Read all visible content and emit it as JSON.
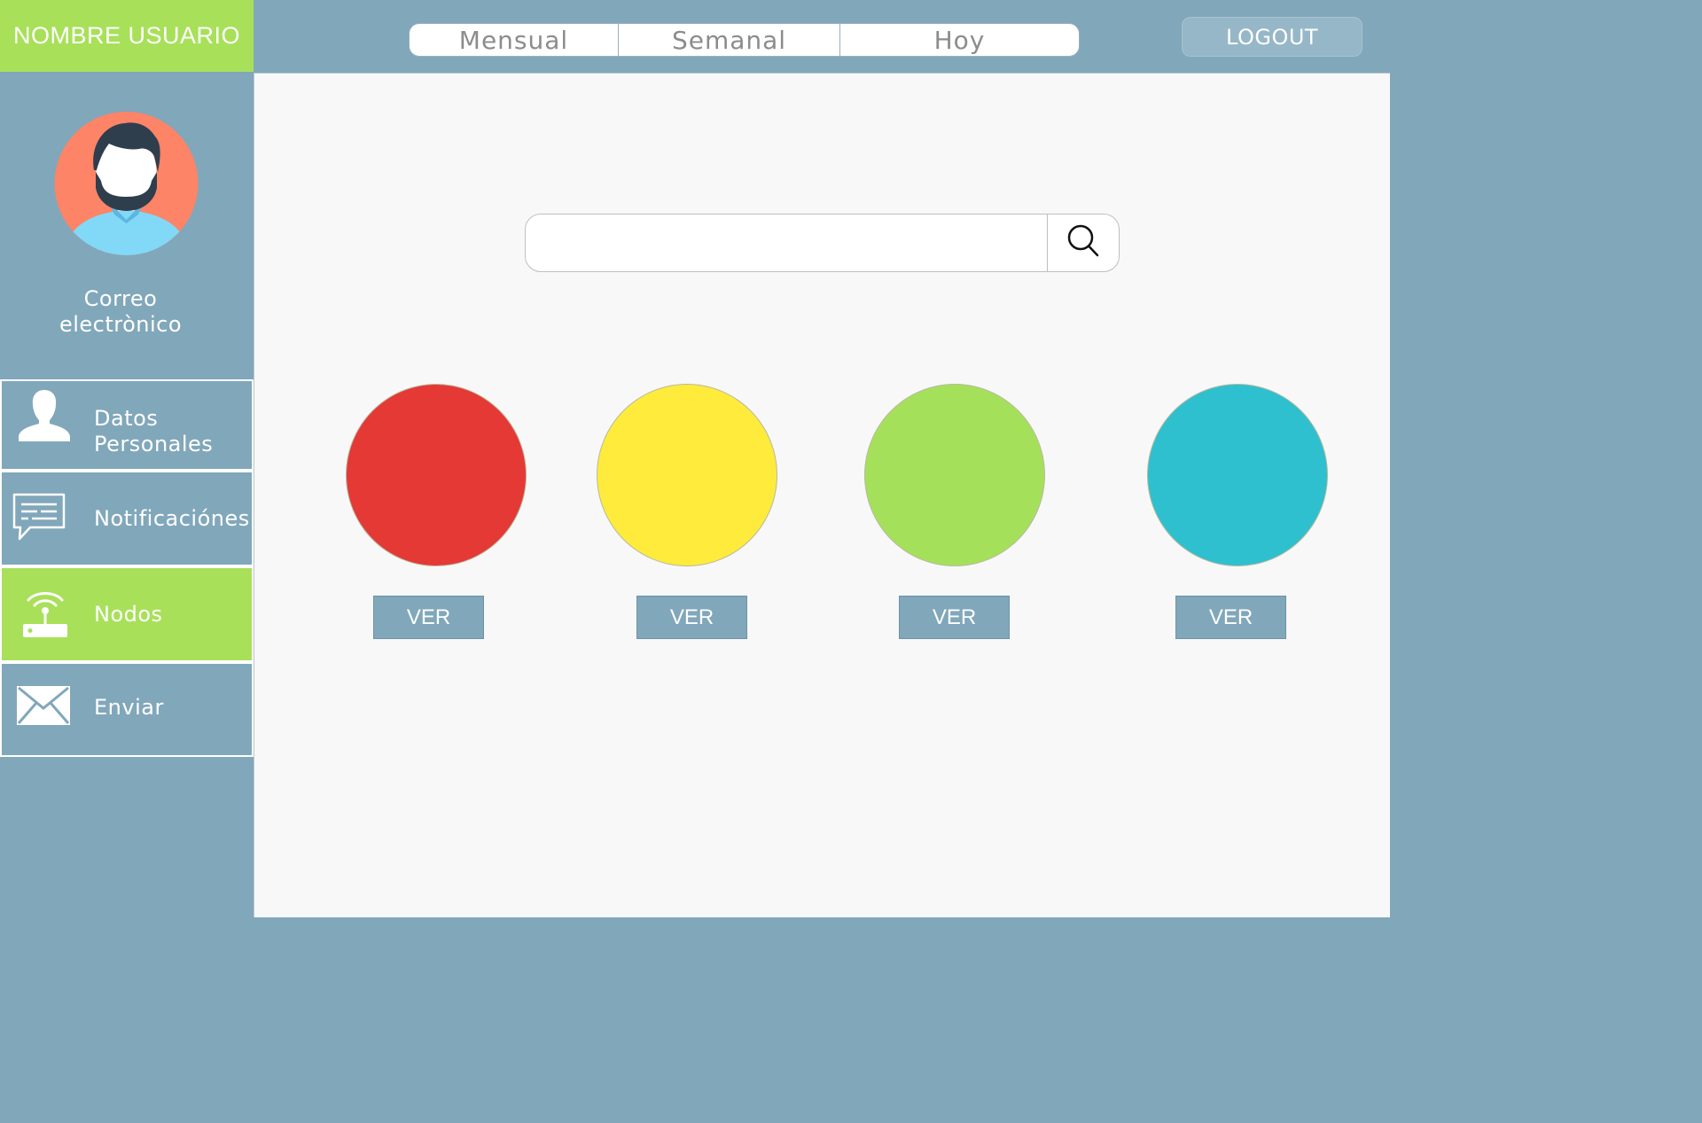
{
  "header": {
    "user_name": "NOMBRE USUARIO",
    "tabs": [
      {
        "label": "Mensual"
      },
      {
        "label": "Semanal"
      },
      {
        "label": "Hoy"
      }
    ],
    "logout_label": "LOGOUT"
  },
  "sidebar": {
    "avatar_icon": "user-avatar-icon",
    "email_line1": "Correo",
    "email_line2": "electrònico",
    "items": [
      {
        "line1": "Datos",
        "line2": "Personales",
        "icon": "person-icon",
        "active": false
      },
      {
        "label": "Notificaciónes",
        "icon": "chat-icon",
        "active": false
      },
      {
        "label": "Nodos",
        "icon": "router-wifi-icon",
        "active": true
      },
      {
        "label": "Enviar",
        "icon": "envelope-icon",
        "active": false
      }
    ]
  },
  "main": {
    "search": {
      "value": "",
      "placeholder": "",
      "icon": "search-icon"
    },
    "nodes": [
      {
        "color": "#e53935",
        "button": "VER"
      },
      {
        "color": "#ffeb3b",
        "button": "VER"
      },
      {
        "color": "#a5e05a",
        "button": "VER"
      },
      {
        "color": "#2ec0cf",
        "button": "VER"
      }
    ]
  },
  "colors": {
    "accent_green": "#a8e05a",
    "panel_blue": "#81a7ba",
    "content_bg": "#f8f8f8"
  }
}
